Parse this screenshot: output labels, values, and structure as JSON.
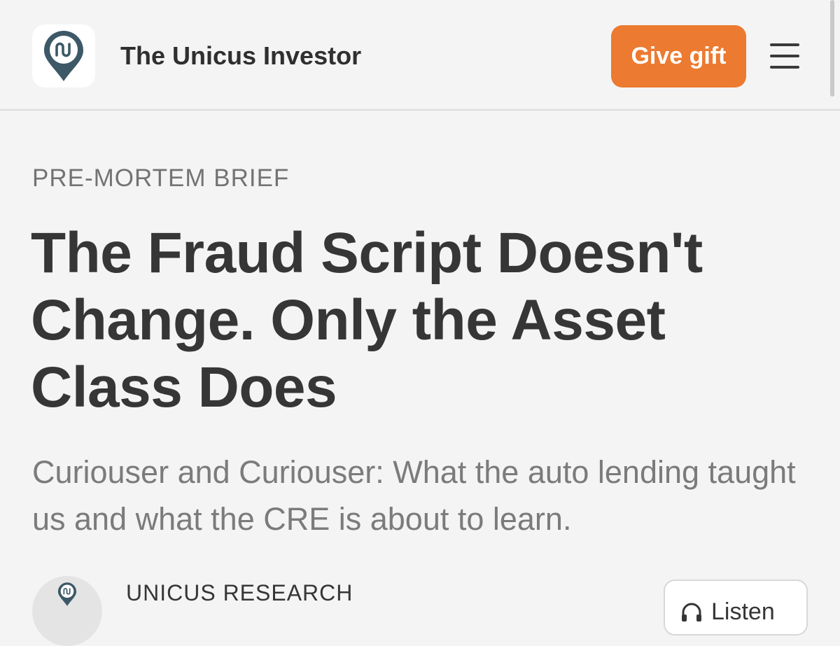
{
  "header": {
    "site_title": "The Unicus Investor",
    "gift_label": "Give gift",
    "brand_color": "#ec7a30",
    "logo_icon": "map-pin-logo-icon",
    "menu_icon": "hamburger-menu-icon"
  },
  "article": {
    "kicker": "PRE-MORTEM BRIEF",
    "title": "The Fraud Script Doesn't Change. Only the Asset Class Does",
    "subtitle": "Curiouser and Curiouser: What the auto lending taught us and what the CRE is about to learn."
  },
  "byline": {
    "author": "UNICUS RESEARCH",
    "listen_label": "Listen",
    "listen_icon": "headphones-icon"
  }
}
